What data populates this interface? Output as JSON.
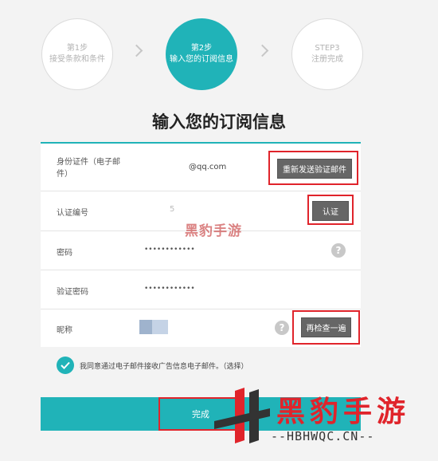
{
  "steps": [
    {
      "line1": "第1步",
      "line2": "接受条款和条件"
    },
    {
      "line1": "第2步",
      "line2": "输入您的订阅信息"
    },
    {
      "line1": "STEP3",
      "line2": "注册完成"
    }
  ],
  "title": "输入您的订阅信息",
  "form": {
    "email": {
      "label": "身份证件（电子邮件）",
      "value": "@qq.com",
      "button": "重新发送验证邮件"
    },
    "code": {
      "label": "认证编号",
      "value": "5",
      "button": "认证"
    },
    "password": {
      "label": "密码",
      "value": "••••••••••••"
    },
    "confirm": {
      "label": "验证密码",
      "value": "••••••••••••"
    },
    "nickname": {
      "label": "昵称",
      "button": "再检查一遍"
    }
  },
  "agree_text": "我同意通过电子邮件接收广告信息电子邮件。（选择）",
  "done_label": "完成",
  "watermark": {
    "small": "黑豹手游",
    "large": "黑豹手游",
    "url": "--HBHWQC.CN--"
  },
  "colors": {
    "accent": "#20b3b8",
    "highlight": "#e0242b"
  }
}
